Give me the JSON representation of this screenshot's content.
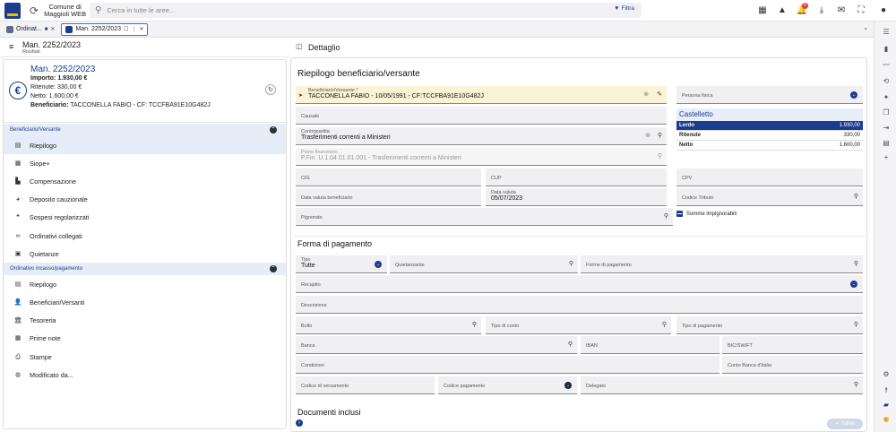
{
  "app": {
    "brand_line1": "Comune di",
    "brand_line2": "Maggioli WEB",
    "search_placeholder": "Cerca in tutte le aree...",
    "filtra": "Filtra",
    "notif_count": "6"
  },
  "tabs": [
    {
      "label": "Ordinat..."
    },
    {
      "label": "Man. 2252/2023"
    }
  ],
  "left": {
    "header_title": "Man. 2252/2023",
    "header_sub": "Risultati",
    "summary": {
      "title": "Man. 2252/2023",
      "importo": "Importo: 1.930,00 €",
      "ritenute": "Ritenute: 330,00 €",
      "netto": "Netto: 1.600,00 €",
      "beneficiario_label": "Beneficiario:",
      "beneficiario": "TACCONELLA FABIO - CF: TCCFBA91E10G482J"
    },
    "section1": "Beneficiario/Versante",
    "nav1": [
      "Riepilogo",
      "Siope+",
      "Compensazione",
      "Deposito cauzionale",
      "Sospesi regolarizzati",
      "Ordinativi collegati",
      "Quietanze"
    ],
    "section2": "Ordinativo incasso/pagamento",
    "nav2": [
      "Riepilogo",
      "Beneficiari/Versanti",
      "Tesoreria",
      "Prime note",
      "Stampe",
      "Modificato da..."
    ]
  },
  "detail": {
    "header": "Dettaglio",
    "title": "Riepilogo beneficiario/versante",
    "benef_label": "Beneficiario/Versante *",
    "benef_value": "TACCONELLA FABIO - 10/05/1991 - CF:TCCFBA91E10G482J",
    "persona": "Persona fisica",
    "causale": "Causale",
    "contropartita_label": "Contropartita",
    "contropartita_value": "Trasferimenti correnti a Ministeri",
    "piano_label": "Piano finanziario",
    "piano_value": "P.Fin. U.1.04.01.01.001 - Trasferimenti correnti a Ministeri",
    "cig": "CIG",
    "cup": "CUP",
    "cpv": "CPV",
    "data_valuta_benef": "Data valuta beneficiario",
    "data_valuta_label": "Data valuta",
    "data_valuta_value": "05/07/2023",
    "codice_tributo": "Codice Tributo",
    "pignorato": "Pignorato",
    "castelletto": {
      "title": "Castelletto",
      "rows": [
        {
          "label": "Lordo",
          "value": "1.930,00"
        },
        {
          "label": "Ritenute",
          "value": "330,00"
        },
        {
          "label": "Netto",
          "value": "1.600,00"
        }
      ]
    },
    "somme": "Somme impignorabili",
    "forma": {
      "title": "Forma di pagamento",
      "tipo_label": "Tipo",
      "tipo_value": "Tutte",
      "quietanzante": "Quietanzante",
      "forme": "Forme di pagamento",
      "recapito": "Recapito",
      "descrizione": "Descrizione",
      "bollo": "Bollo",
      "tipo_conto": "Tipo di conto",
      "tipo_pagamento": "Tipo di pagamento",
      "banca": "Banca",
      "iban": "IBAN",
      "bic": "BIC/SWIFT",
      "condizioni": "Condizioni",
      "conto_bi": "Conto Banca d'Italia",
      "codice_versamento": "Codice di versamento",
      "codice_pagamento": "Codice pagamento",
      "delegato": "Delegato"
    },
    "documenti": "Documenti inclusi",
    "salva": "Salva"
  }
}
